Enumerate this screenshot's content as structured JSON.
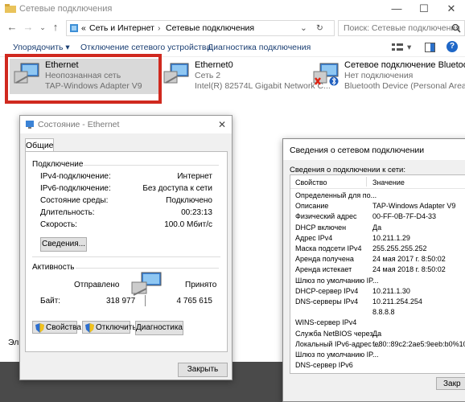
{
  "window": {
    "title": "Сетевые подключения",
    "controls": [
      "—",
      "☐",
      "✕"
    ]
  },
  "address": {
    "breadcrumb_prefix": "«",
    "crumbs": [
      "Сеть и Интернет",
      "Сетевые подключения"
    ],
    "separator": "›",
    "search_placeholder": "Поиск: Сетевые подключения"
  },
  "commands": {
    "organize": "Упорядочить ▾",
    "disable": "Отключение сетевого устройства",
    "diagnose": "Диагностика подключения"
  },
  "adapters": [
    {
      "name": "Ethernet",
      "status": "Неопознанная сеть",
      "device": "TAP-Windows Adapter V9"
    },
    {
      "name": "Ethernet0",
      "status": "Сеть  2",
      "device": "Intel(R) 82574L Gigabit Network C..."
    },
    {
      "name": "Сетевое подключение Bluetooth",
      "status": "Нет подключения",
      "device": "Bluetooth Device (Personal Area ..."
    }
  ],
  "colors": {
    "highlight": "#d0291f",
    "selected": "#cce8ff",
    "link": "#1a3e72"
  },
  "status_dialog": {
    "title": "Состояние - Ethernet",
    "tab": "Общие",
    "connection_header": "Подключение",
    "rows": [
      {
        "label": "IPv4-подключение:",
        "value": "Интернет"
      },
      {
        "label": "IPv6-подключение:",
        "value": "Без доступа к сети"
      },
      {
        "label": "Состояние среды:",
        "value": "Подключено"
      },
      {
        "label": "Длительность:",
        "value": "00:23:13"
      },
      {
        "label": "Скорость:",
        "value": "100.0 Мбит/с"
      }
    ],
    "details_button": "Сведения...",
    "activity_header": "Активность",
    "sent_label": "Отправлено",
    "received_label": "Принято",
    "bytes_label": "Байт:",
    "bytes_sent": "318 977",
    "bytes_received": "4 765 615",
    "props_button": "Свойства",
    "disable_button": "Отключить",
    "diag_button": "Диагностика",
    "close_button": "Закрыть"
  },
  "details_dialog": {
    "title": "Сведения о сетевом подключении",
    "subtitle": "Сведения о подключении к сети:",
    "col_property": "Свойство",
    "col_value": "Значение",
    "rows": [
      {
        "p": "Определенный для по...",
        "v": ""
      },
      {
        "p": "Описание",
        "v": "TAP-Windows Adapter V9"
      },
      {
        "p": "Физический адрес",
        "v": "00-FF-0B-7F-D4-33"
      },
      {
        "p": "DHCP включен",
        "v": "Да"
      },
      {
        "p": "Адрес IPv4",
        "v": "10.211.1.29"
      },
      {
        "p": "Маска подсети IPv4",
        "v": "255.255.255.252"
      },
      {
        "p": "Аренда получена",
        "v": "24 мая 2017 г. 8:50:02"
      },
      {
        "p": "Аренда истекает",
        "v": "24 мая 2018 г. 8:50:02"
      },
      {
        "p": "Шлюз по умолчанию IP...",
        "v": ""
      },
      {
        "p": "DHCP-сервер IPv4",
        "v": "10.211.1.30"
      },
      {
        "p": "DNS-серверы IPv4",
        "v": "10.211.254.254"
      },
      {
        "p": "",
        "v": "8.8.8.8"
      },
      {
        "p": "WINS-сервер IPv4",
        "v": ""
      },
      {
        "p": "Служба NetBIOS через...",
        "v": "Да"
      },
      {
        "p": "Локальный IPv6-адрес ...",
        "v": "fe80::89c2:2ae5:9eeb:b0%10"
      },
      {
        "p": "Шлюз по умолчанию IP...",
        "v": ""
      },
      {
        "p": "DNS-сервер IPv6",
        "v": ""
      }
    ],
    "close_button": "Закр"
  },
  "left_edge_text": "Эл"
}
